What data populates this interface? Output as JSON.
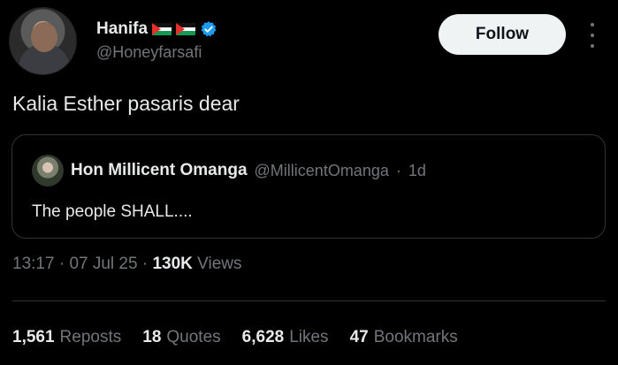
{
  "author": {
    "display_name": "Hanifa",
    "handle": "@Honeyfarsafi",
    "flags": [
      "palestine-flag",
      "palestine-flag"
    ],
    "verified_icon": "verified-badge-icon"
  },
  "follow_button": {
    "label": "Follow"
  },
  "more_icon": "more-options-icon",
  "tweet": {
    "text": "Kalia Esther pasaris dear"
  },
  "quoted": {
    "display_name": "Hon Millicent Omanga",
    "handle": "@MillicentOmanga",
    "separator": "·",
    "age": "1d",
    "text": "The people SHALL...."
  },
  "meta": {
    "time": "13:17",
    "sep1": "·",
    "date": "07 Jul 25",
    "sep2": "·",
    "views_count": "130K",
    "views_label": "Views"
  },
  "stats": [
    {
      "count": "1,561",
      "label": "Reposts"
    },
    {
      "count": "18",
      "label": "Quotes"
    },
    {
      "count": "6,628",
      "label": "Likes"
    },
    {
      "count": "47",
      "label": "Bookmarks"
    }
  ],
  "colors": {
    "background": "#000000",
    "text": "#e7e9ea",
    "muted": "#71767b",
    "verified": "#1d9bf0",
    "border": "#2f3336"
  }
}
